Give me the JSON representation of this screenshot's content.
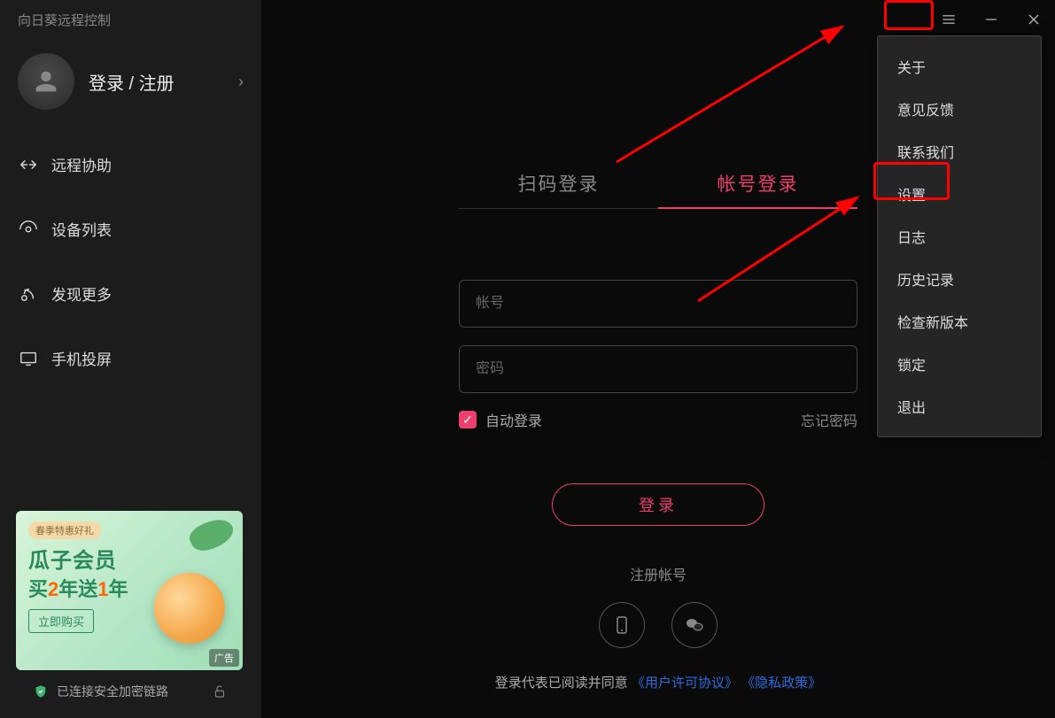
{
  "app_title": "向日葵远程控制",
  "sidebar": {
    "login_label": "登录 / 注册",
    "nav": [
      {
        "label": "远程协助"
      },
      {
        "label": "设备列表"
      },
      {
        "label": "发现更多"
      },
      {
        "label": "手机投屏"
      }
    ],
    "ad": {
      "badge_top": "春季特惠好礼",
      "line1": "瓜子会员",
      "line2_prefix": "买",
      "line2_num1": "2",
      "line2_mid": "年送",
      "line2_num2": "1",
      "line2_suffix": "年",
      "cta": "立即购买",
      "badge_br": "广告"
    },
    "status_text": "已连接安全加密链路"
  },
  "main": {
    "tabs": {
      "scan": "扫码登录",
      "account": "帐号登录"
    },
    "form": {
      "account_placeholder": "帐号",
      "password_placeholder": "密码",
      "auto_login": "自动登录",
      "forgot": "忘记密码",
      "login_btn": "登录",
      "register_link": "注册帐号"
    },
    "consent_prefix": "登录代表已阅读并同意",
    "consent_link1": "《用户许可协议》",
    "consent_link2": "《隐私政策》"
  },
  "menu": {
    "items": [
      "关于",
      "意见反馈",
      "联系我们",
      "设置",
      "日志",
      "历史记录",
      "检查新版本",
      "锁定",
      "退出"
    ]
  }
}
